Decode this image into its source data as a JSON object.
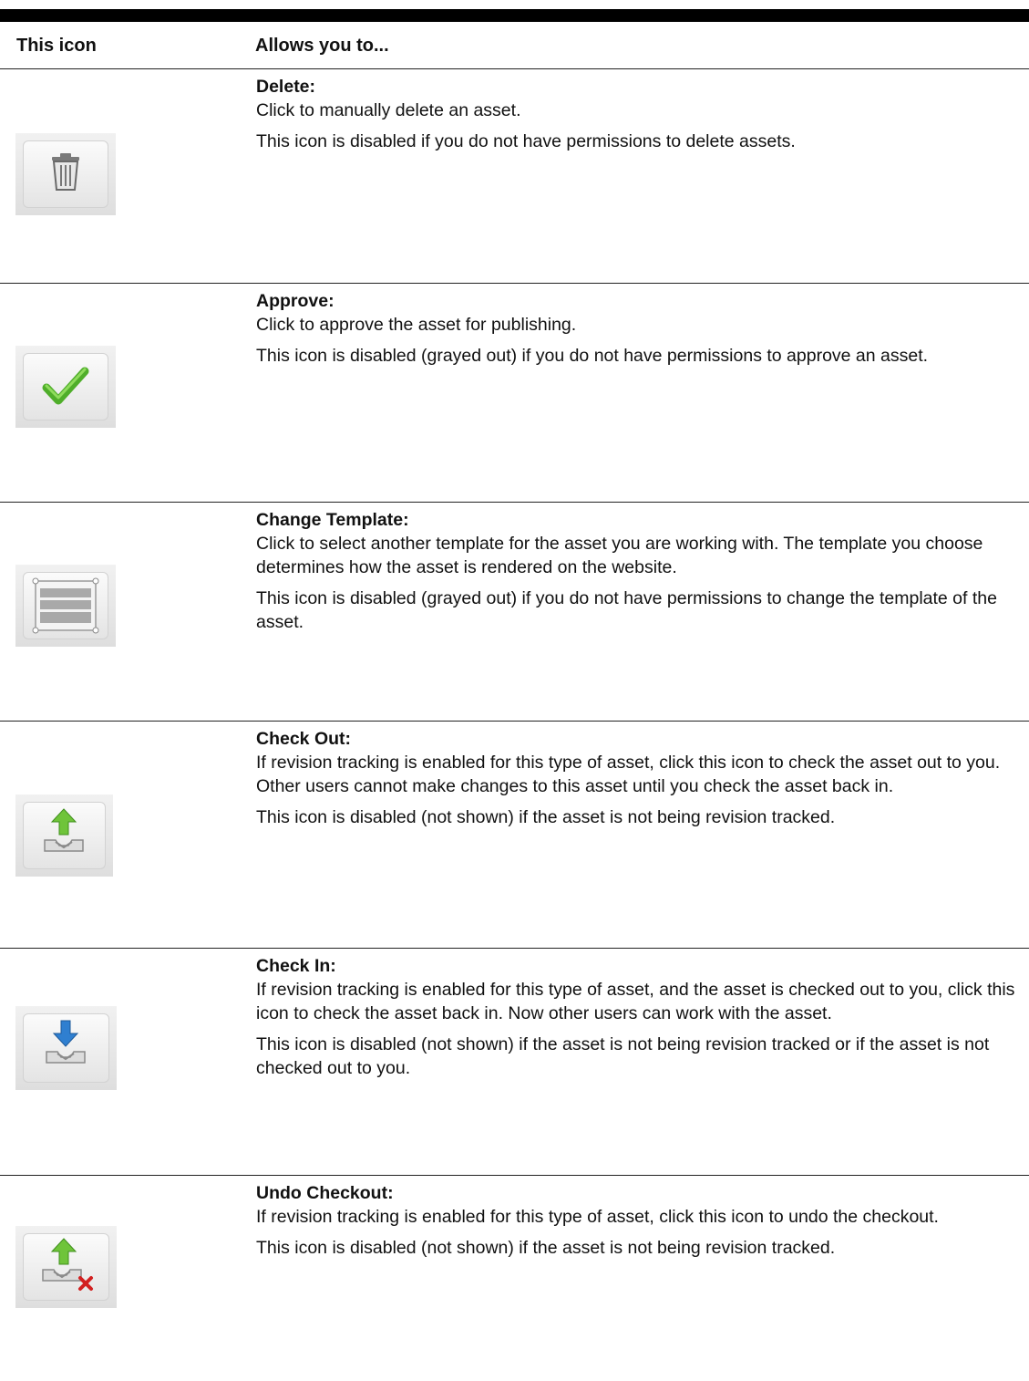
{
  "table": {
    "col1_header": "This icon",
    "col2_header": "Allows you to...",
    "rows": [
      {
        "icon": "trash-icon",
        "title": "Delete:",
        "paragraphs": [
          "Click to manually delete an asset.",
          "This icon is disabled if you do not have permissions to delete assets."
        ]
      },
      {
        "icon": "checkmark-icon",
        "title": "Approve:",
        "paragraphs": [
          "Click to approve the asset for publishing.",
          "This icon is disabled (grayed out) if you do not have permissions to approve an asset."
        ]
      },
      {
        "icon": "template-icon",
        "title": "Change Template:",
        "paragraphs": [
          "Click to select another template for the asset you are working with. The template you choose determines how the asset is rendered on the website.",
          "This icon is disabled (grayed out) if you do not have permissions to change the template of the asset."
        ]
      },
      {
        "icon": "check-out-icon",
        "title": "Check Out:",
        "paragraphs": [
          "If revision tracking is enabled for this type of asset, click this icon to check the asset out to you. Other users cannot make changes to this asset until you check the asset back in.",
          "This icon is disabled (not shown) if the asset is not being revision tracked."
        ]
      },
      {
        "icon": "check-in-icon",
        "title": "Check In:",
        "paragraphs": [
          "If revision tracking is enabled for this type of asset, and the asset is checked out to you, click this icon to check the asset back in. Now other users can work with the asset.",
          "This icon is disabled (not shown) if the asset is not being revision tracked or if the asset is not checked out to you."
        ]
      },
      {
        "icon": "undo-checkout-icon",
        "title": "Undo Checkout:",
        "paragraphs": [
          "If revision tracking is enabled for this type of asset, click this icon to undo the checkout.",
          "This icon is disabled (not shown) if the asset is not being revision tracked."
        ]
      }
    ]
  },
  "colors": {
    "arrow_green": "#6fc43a",
    "arrow_blue": "#2f7fd0",
    "check_green": "#4fae2a",
    "x_red": "#d22020",
    "tray_gray": "#8a8a8a"
  }
}
